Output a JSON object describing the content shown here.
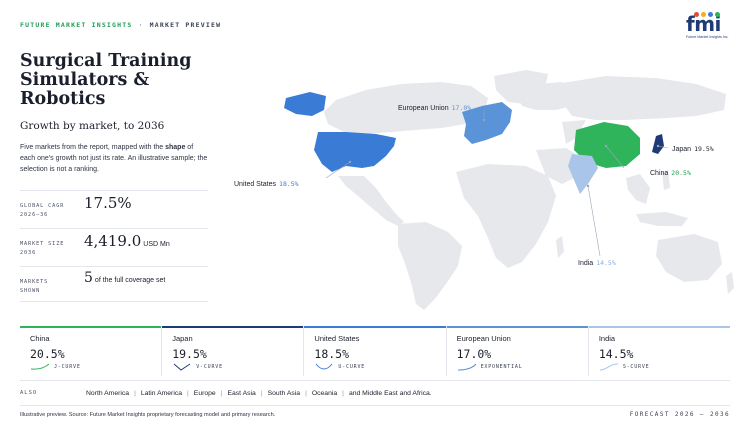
{
  "header": {
    "brand": "FUTURE MARKET INSIGHTS",
    "separator": "·",
    "section": "MARKET PREVIEW"
  },
  "logo": {
    "letters": "fmi",
    "tagline": "Future Market Insights Inc.",
    "dot_colors": [
      "#e84b3c",
      "#f2b01e",
      "#3a7bd5",
      "#2fb35b"
    ]
  },
  "title": "Surgical Training Simulators & Robotics",
  "subtitle": "Growth by market, to 2036",
  "description": {
    "part1": "Five markets from the report, mapped with the ",
    "bold": "shape",
    "part2": " of each one's growth not just its rate. An illustrative sample; the selection is not a ranking."
  },
  "stats": {
    "cagr": {
      "label1": "GLOBAL CAGR",
      "label2": "2026–36",
      "value": "17.5%"
    },
    "size": {
      "label1": "MARKET SIZE",
      "label2": "2036",
      "value": "4,419.0",
      "unit": "USD Mn"
    },
    "shown": {
      "label1": "MARKETS",
      "label2": "SHOWN",
      "value": "5",
      "suffix": "of the full coverage set"
    }
  },
  "map_labels": {
    "eu": {
      "name": "European Union",
      "value": "17.0%"
    },
    "japan": {
      "name": "Japan",
      "value": "19.5%"
    },
    "china": {
      "name": "China",
      "value": "20.5%"
    },
    "us": {
      "name": "United States",
      "value": "18.5%"
    },
    "india": {
      "name": "India",
      "value": "14.5%"
    }
  },
  "colors": {
    "china": "#2fb35b",
    "japan": "#1f3b77",
    "us": "#3a7bd5",
    "eu": "#5b93d9",
    "india": "#a9c6ea",
    "land": "#e6e8ec"
  },
  "cards": [
    {
      "name": "China",
      "value": "20.5%",
      "curve": "J-CURVE",
      "color": "#2fb35b"
    },
    {
      "name": "Japan",
      "value": "19.5%",
      "curve": "V-CURVE",
      "color": "#1f3b77"
    },
    {
      "name": "United States",
      "value": "18.5%",
      "curve": "U-CURVE",
      "color": "#3a7bd5"
    },
    {
      "name": "European Union",
      "value": "17.0%",
      "curve": "EXPONENTIAL",
      "color": "#5b93d9"
    },
    {
      "name": "India",
      "value": "14.5%",
      "curve": "S-CURVE",
      "color": "#a9c6ea"
    }
  ],
  "also": {
    "label": "ALSO",
    "regions": [
      "North America",
      "Latin America",
      "Europe",
      "East Asia",
      "South Asia",
      "Oceania"
    ],
    "tail": "and Middle East and Africa."
  },
  "footer": {
    "note": "Illustrative preview. Source: Future Market Insights proprietary forecasting model and primary research.",
    "forecast": "FORECAST 2026 – 2036"
  }
}
